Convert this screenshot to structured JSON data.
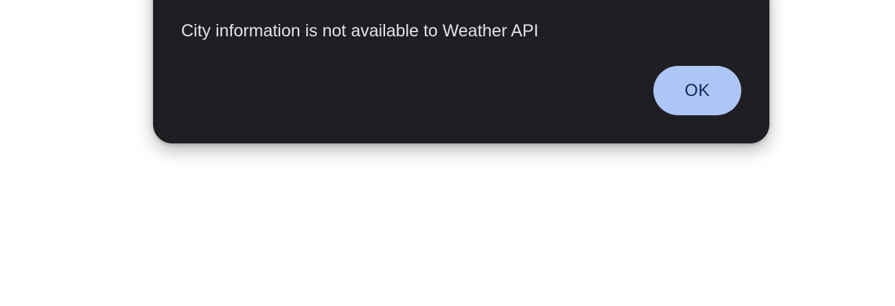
{
  "dialog": {
    "title": "…",
    "message": "City information is not available to Weather API",
    "ok_label": "OK"
  },
  "colors": {
    "page_background": "#ffffff",
    "dialog_background": "#1f1f23",
    "dialog_text": "#e3e3e6",
    "button_background": "#aec6f6",
    "button_text": "#0f2a57"
  }
}
